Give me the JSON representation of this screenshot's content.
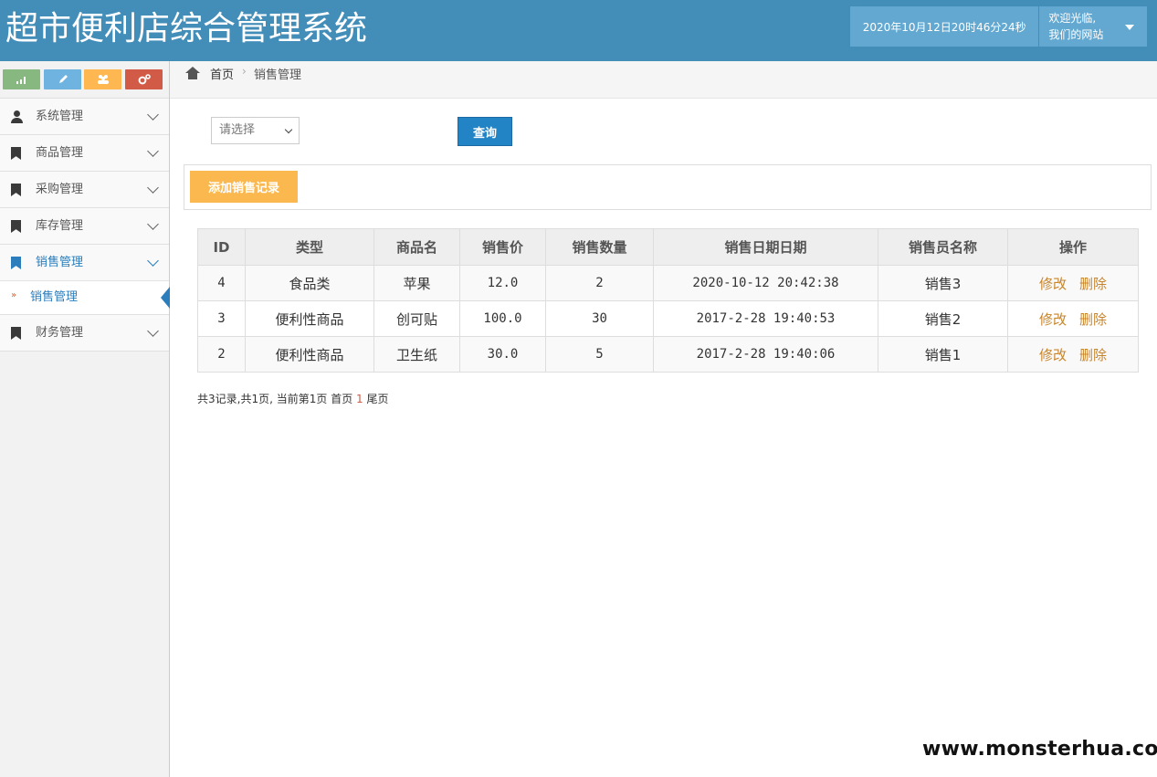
{
  "header": {
    "title": "超市便利店综合管理系统",
    "datetime": "2020年10月12日20时46分24秒",
    "welcome_line1": "欢迎光临,",
    "welcome_line2": "我们的网站"
  },
  "shortcuts": [
    {
      "icon": "signal-icon",
      "color": "#87b87f"
    },
    {
      "icon": "pencil-icon",
      "color": "#6fb3e0"
    },
    {
      "icon": "users-icon",
      "color": "#ffb752"
    },
    {
      "icon": "cogs-icon",
      "color": "#d15b47"
    }
  ],
  "sidebar": {
    "items": [
      {
        "label": "系统管理"
      },
      {
        "label": "商品管理"
      },
      {
        "label": "采购管理"
      },
      {
        "label": "库存管理"
      },
      {
        "label": "销售管理"
      },
      {
        "label": "财务管理"
      }
    ],
    "sub_item": "销售管理"
  },
  "breadcrumb": {
    "home": "首页",
    "current": "销售管理"
  },
  "search": {
    "select_placeholder": "请选择",
    "query_label": "查询"
  },
  "toolbar": {
    "add_label": "添加销售记录"
  },
  "table": {
    "headers": [
      "ID",
      "类型",
      "商品名",
      "销售价",
      "销售数量",
      "销售日期日期",
      "销售员名称",
      "操作"
    ],
    "rows": [
      {
        "id": "4",
        "type": "食品类",
        "name": "苹果",
        "price": "12.0",
        "qty": "2",
        "date": "2020-10-12 20:42:38",
        "seller": "销售3"
      },
      {
        "id": "3",
        "type": "便利性商品",
        "name": "创可贴",
        "price": "100.0",
        "qty": "30",
        "date": "2017-2-28 19:40:53",
        "seller": "销售2"
      },
      {
        "id": "2",
        "type": "便利性商品",
        "name": "卫生纸",
        "price": "30.0",
        "qty": "5",
        "date": "2017-2-28 19:40:06",
        "seller": "销售1"
      }
    ],
    "edit_label": "修改",
    "delete_label": "删除"
  },
  "pager": {
    "summary": "共3记录,共1页, 当前第1页",
    "first": "首页",
    "current": "1",
    "last": "尾页"
  },
  "watermark": "www.monsterhua.com"
}
